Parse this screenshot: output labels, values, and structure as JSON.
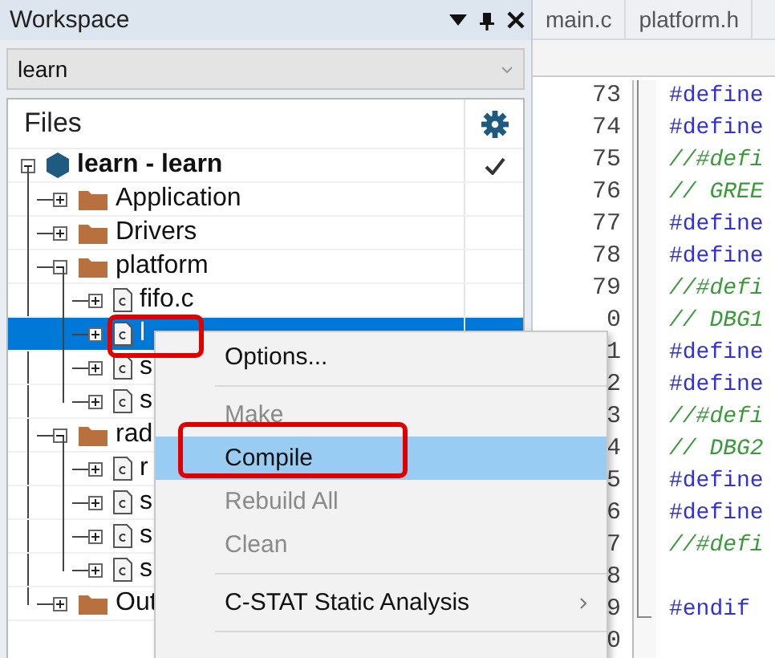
{
  "workspace": {
    "title": "Workspace",
    "selector": {
      "value": "learn"
    },
    "files_header": "Files",
    "tree": [
      {
        "kind": "project",
        "label": "learn - learn",
        "expanded": true,
        "checked": true,
        "selected": false,
        "children": [
          {
            "kind": "folder",
            "label": "Application",
            "expanded": false,
            "checked": false,
            "selected": false
          },
          {
            "kind": "folder",
            "label": "Drivers",
            "expanded": false,
            "checked": false,
            "selected": false
          },
          {
            "kind": "folder",
            "label": "platform",
            "expanded": true,
            "checked": false,
            "selected": false,
            "children": [
              {
                "kind": "file",
                "label": "fifo.c",
                "expanded": false,
                "checked": false,
                "selected": false
              },
              {
                "kind": "file",
                "label": "l",
                "expanded": false,
                "selected": true
              },
              {
                "kind": "file",
                "label": "s",
                "expanded": false,
                "selected": false
              },
              {
                "kind": "file",
                "label": "s",
                "expanded": false,
                "selected": false
              }
            ]
          },
          {
            "kind": "folder",
            "label": "rad",
            "expanded": true,
            "selected": false,
            "children": [
              {
                "kind": "file",
                "label": "r",
                "expanded": false,
                "selected": false
              },
              {
                "kind": "file",
                "label": "s",
                "expanded": false,
                "selected": false
              },
              {
                "kind": "file",
                "label": "s",
                "expanded": false,
                "selected": false
              },
              {
                "kind": "file",
                "label": "s",
                "expanded": false,
                "selected": false
              }
            ]
          },
          {
            "kind": "folder",
            "label": "Out",
            "expanded": false,
            "selected": false
          }
        ]
      }
    ]
  },
  "editor": {
    "tabs": [
      {
        "label": "main.c",
        "selected": false
      },
      {
        "label": "platform.h",
        "selected": false
      }
    ],
    "lines": [
      {
        "number": "73",
        "kind": "directive",
        "text": "#define"
      },
      {
        "number": "74",
        "kind": "directive",
        "text": "#define"
      },
      {
        "number": "75",
        "kind": "comment",
        "text": "//#defi"
      },
      {
        "number": "76",
        "kind": "comment",
        "text": "// GREE"
      },
      {
        "number": "77",
        "kind": "directive",
        "text": "#define"
      },
      {
        "number": "78",
        "kind": "directive",
        "text": "#define"
      },
      {
        "number": "79",
        "kind": "comment",
        "text": "//#defi"
      },
      {
        "number": "0",
        "kind": "comment",
        "text": "// DBG1"
      },
      {
        "number": "1",
        "kind": "directive",
        "text": "#define"
      },
      {
        "number": "2",
        "kind": "directive",
        "text": "#define"
      },
      {
        "number": "3",
        "kind": "comment",
        "text": "//#defi"
      },
      {
        "number": "4",
        "kind": "comment",
        "text": "// DBG2"
      },
      {
        "number": "5",
        "kind": "directive",
        "text": "#define"
      },
      {
        "number": "6",
        "kind": "directive",
        "text": "#define"
      },
      {
        "number": "7",
        "kind": "comment",
        "text": "//#defi"
      },
      {
        "number": "8",
        "kind": "blank"
      },
      {
        "number": "9",
        "kind": "directive",
        "text": "#endif"
      },
      {
        "number": "0",
        "kind": "blank"
      }
    ]
  },
  "context_menu": {
    "items": [
      {
        "kind": "item",
        "label": "Options...",
        "disabled": false,
        "selected": false,
        "submenu": false
      },
      {
        "kind": "separator"
      },
      {
        "kind": "item",
        "label": "Make",
        "disabled": true,
        "selected": false,
        "submenu": false
      },
      {
        "kind": "item",
        "label": "Compile",
        "disabled": false,
        "selected": true,
        "submenu": false
      },
      {
        "kind": "item",
        "label": "Rebuild All",
        "disabled": true,
        "selected": false,
        "submenu": false
      },
      {
        "kind": "item",
        "label": "Clean",
        "disabled": true,
        "selected": false,
        "submenu": false
      },
      {
        "kind": "separator"
      },
      {
        "kind": "item",
        "label": "C-STAT Static Analysis",
        "disabled": false,
        "selected": false,
        "submenu": true
      },
      {
        "kind": "separator"
      }
    ]
  }
}
